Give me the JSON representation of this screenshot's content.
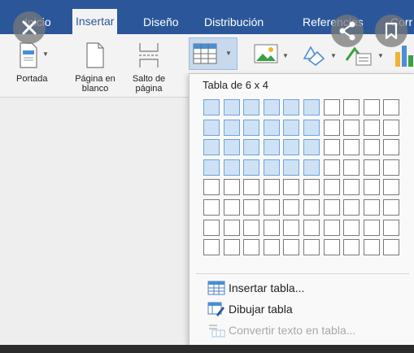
{
  "ribbon": {
    "tabs": [
      {
        "label": "Inicio"
      },
      {
        "label": "Insertar"
      },
      {
        "label": "Diseño"
      },
      {
        "label": "Distribución"
      },
      {
        "label": "Referencias"
      },
      {
        "label": "Corr"
      }
    ],
    "active_tab": "Insertar",
    "pages_group": {
      "cover": "Portada",
      "blank_page": "Página en blanco",
      "page_break_line1": "Salto de",
      "page_break_line2": "página"
    }
  },
  "overlay": {
    "close_icon": "close-icon",
    "share_icon": "share-icon",
    "bookmark_icon": "bookmark-icon"
  },
  "table_dropdown": {
    "title": "Tabla de 6 x 4",
    "grid": {
      "columns": 10,
      "rows": 8,
      "selected_columns": 6,
      "selected_rows": 4
    },
    "menu": [
      {
        "label": "Insertar tabla...",
        "icon": "table-icon",
        "enabled": true
      },
      {
        "label": "Dibujar tabla",
        "icon": "draw-table-icon",
        "enabled": true
      },
      {
        "label": "Convertir texto en tabla...",
        "icon": "convert-text-icon",
        "enabled": false
      }
    ]
  },
  "colors": {
    "ribbon_blue": "#2b579a",
    "cell_selected": "#cfe2f5",
    "cell_selected_border": "#6fa3d6"
  }
}
